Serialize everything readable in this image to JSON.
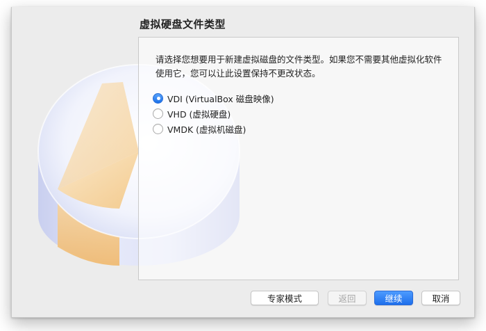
{
  "dialog": {
    "title": "虚拟硬盘文件类型",
    "description": "请选择您想要用于新建虚拟磁盘的文件类型。如果您不需要其他虚拟化软件使用它，您可以让此设置保持不更改状态。",
    "options": [
      {
        "label": "VDI (VirtualBox 磁盘映像)",
        "selected": true
      },
      {
        "label": "VHD (虚拟硬盘)",
        "selected": false
      },
      {
        "label": "VMDK (虚拟机磁盘)",
        "selected": false
      }
    ]
  },
  "buttons": {
    "expert": "专家模式",
    "back": "返回",
    "continue": "继续",
    "cancel": "取消"
  },
  "colors": {
    "accent": "#1e6fec",
    "sheet_bg": "#ececec"
  }
}
